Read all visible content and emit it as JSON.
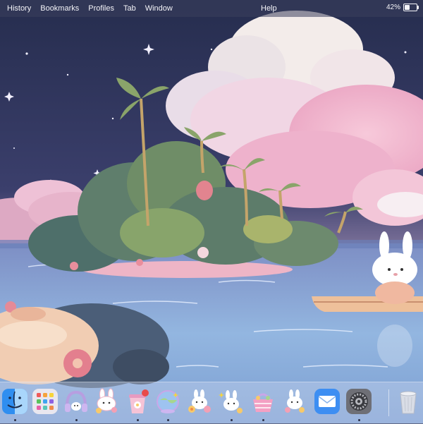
{
  "menubar": {
    "items": [
      "History",
      "Bookmarks",
      "Profiles",
      "Tab",
      "Window"
    ],
    "help": "Help",
    "battery": {
      "percent_label": "42%",
      "level": 0.42
    }
  },
  "wallpaper": {
    "description_icon": "island-bunny-wallpaper"
  },
  "dock": {
    "apps": [
      {
        "name": "finder-icon",
        "running": true
      },
      {
        "name": "launchpad-icon",
        "running": false
      },
      {
        "name": "headphones-bunny-icon",
        "running": true
      },
      {
        "name": "bunny-sticker-icon",
        "running": false
      },
      {
        "name": "cup-icon",
        "running": true
      },
      {
        "name": "globe-icon",
        "running": true
      },
      {
        "name": "bunny-flowers-icon",
        "running": false
      },
      {
        "name": "bunny-sparkle-icon",
        "running": true
      },
      {
        "name": "basket-icon",
        "running": true
      },
      {
        "name": "bunny-flowers-2-icon",
        "running": false
      },
      {
        "name": "mail-icon",
        "running": false
      },
      {
        "name": "system-settings-icon",
        "running": true
      },
      {
        "name": "trash-icon",
        "running": false
      }
    ]
  }
}
